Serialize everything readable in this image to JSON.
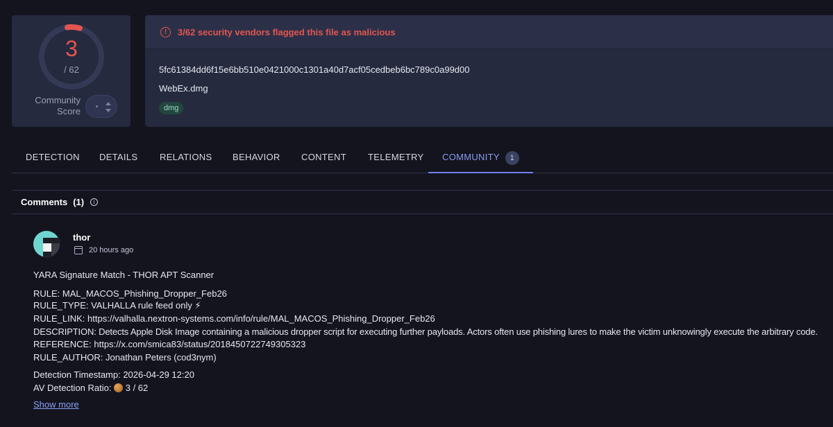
{
  "score": {
    "detected": "3",
    "total": "/ 62",
    "community_label": "Community Score",
    "accent": "#e4554f"
  },
  "alert": {
    "icon": "alert-circle-icon",
    "text": "3/62 security vendors flagged this file as malicious"
  },
  "file": {
    "hash": "5fc61384dd6f15e6bb510e0421000c1301a40d7acf05cedbeb6bc789c0a99d00",
    "name": "WebEx.dmg",
    "tag": "dmg"
  },
  "tabs": [
    {
      "label": "DETECTION"
    },
    {
      "label": "DETAILS"
    },
    {
      "label": "RELATIONS"
    },
    {
      "label": "BEHAVIOR"
    },
    {
      "label": "CONTENT"
    },
    {
      "label": "TELEMETRY"
    },
    {
      "label": "COMMUNITY",
      "badge": "1",
      "active": true
    }
  ],
  "comments": {
    "title": "Comments",
    "count": "(1)"
  },
  "comment": {
    "author": "thor",
    "time": "20 hours ago",
    "lines": [
      "YARA Signature Match - THOR APT Scanner",
      "RULE: MAL_MACOS_Phishing_Dropper_Feb26",
      "RULE_TYPE: VALHALLA rule feed only ⚡",
      "RULE_LINK: https://valhalla.nextron-systems.com/info/rule/MAL_MACOS_Phishing_Dropper_Feb26",
      "DESCRIPTION: Detects Apple Disk Image containing a malicious dropper script for executing further payloads. Actors often use phishing lures to make the victim unknowingly execute the arbitrary code.",
      "REFERENCE: https://x.com/smica83/status/2018450722749305323",
      "RULE_AUTHOR: Jonathan Peters (cod3nym)",
      "Detection Timestamp: 2026-04-29 12:20"
    ],
    "ratio_label": "AV Detection Ratio:",
    "ratio_value": "3 / 62",
    "show_more": "Show more"
  }
}
